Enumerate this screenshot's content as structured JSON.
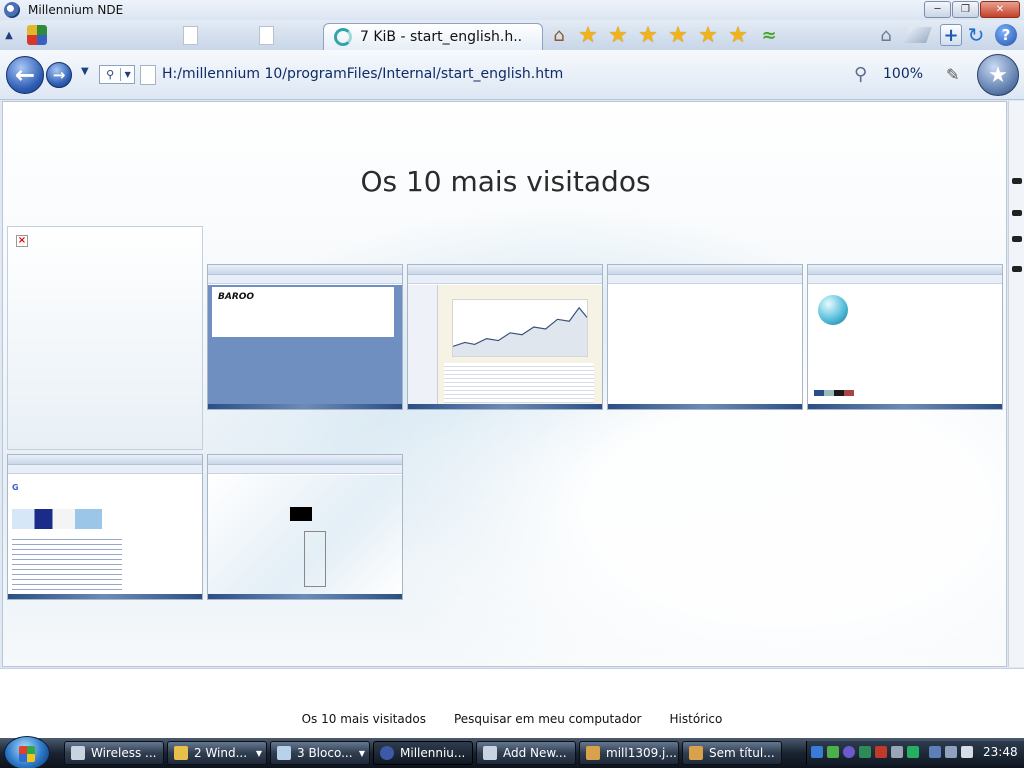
{
  "window": {
    "title": "Millennium NDE"
  },
  "tabs": {
    "active_label": "7 KiB - start_english.h..",
    "star_count": 6
  },
  "nav": {
    "address": "H:/millennium 10/programFiles/Internal/start_english.htm",
    "zoom": "100%"
  },
  "content": {
    "heading": "Os 10 mais visitados",
    "thumb1_logo": "BAROO"
  },
  "footer": {
    "links": [
      "Os 10 mais visitados",
      "Pesquisar em meu computador",
      "Histórico"
    ]
  },
  "taskbar": {
    "items": [
      {
        "label": "Wireless ...",
        "icon_color": "#d8dde6",
        "dropdown": false
      },
      {
        "label": "2 Wind...",
        "icon_color": "#e6c04a",
        "dropdown": true
      },
      {
        "label": "3 Bloco...",
        "icon_color": "#b7d2ea",
        "dropdown": true
      },
      {
        "label": "Millenniu...",
        "icon_color": "#3b5aa8",
        "dropdown": false
      },
      {
        "label": "Add New...",
        "icon_color": "#e8e8e8",
        "dropdown": false
      },
      {
        "label": "mill1309.j...",
        "icon_color": "#d9a24a",
        "dropdown": false
      },
      {
        "label": "Sem títul...",
        "icon_color": "#d9a24a",
        "dropdown": false
      }
    ],
    "clock": "23:48"
  }
}
